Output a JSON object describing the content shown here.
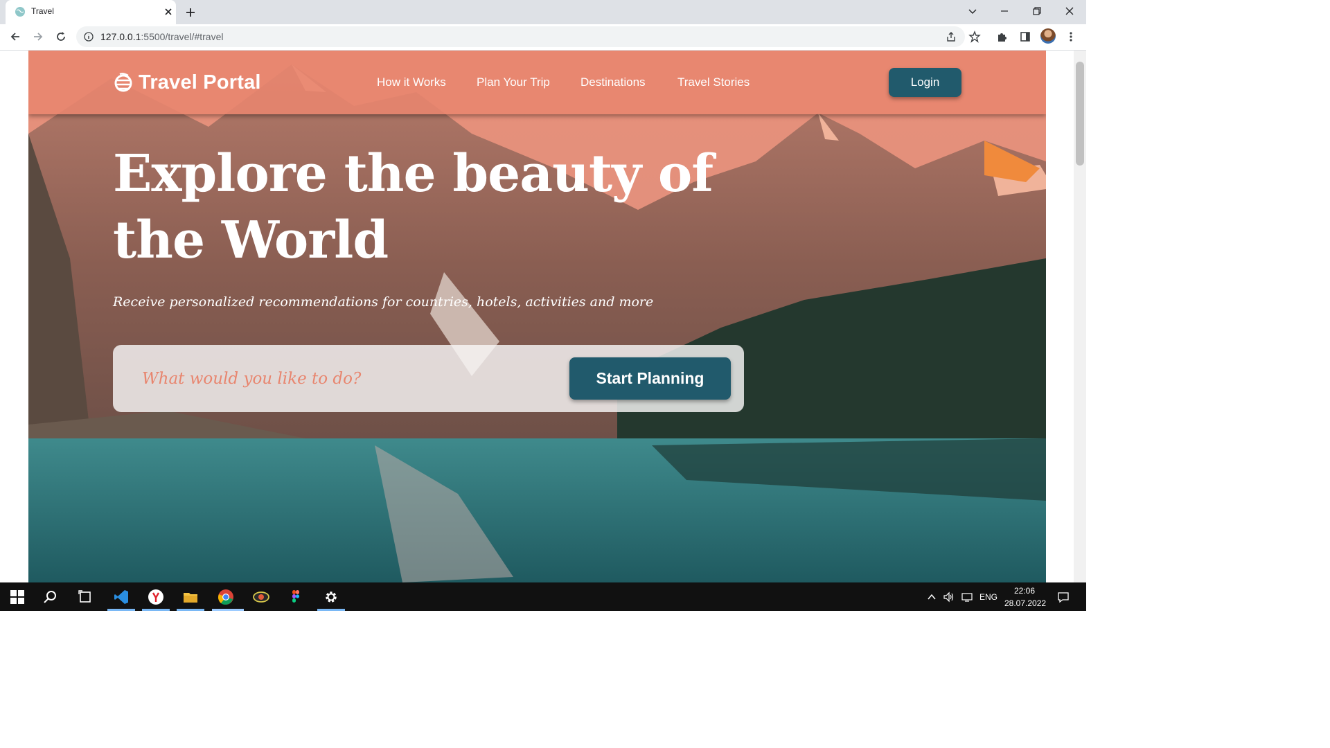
{
  "browser": {
    "tab_title": "Travel",
    "url_host": "127.0.0.1",
    "url_rest": ":5500/travel/#travel"
  },
  "nav": {
    "brand": "Travel Portal",
    "links": [
      "How it Works",
      "Plan Your Trip",
      "Destinations",
      "Travel Stories"
    ],
    "login_label": "Login"
  },
  "hero": {
    "headline_line1": "Explore the beauty of",
    "headline_line2": "the World",
    "subtitle": "Receive personalized recommendations for countries, hotels, activities and more",
    "search_placeholder": "What would you like to do?",
    "cta_label": "Start Planning"
  },
  "taskbar": {
    "lang": "ENG",
    "time": "22:06",
    "date": "28.07.2022"
  },
  "colors": {
    "navbar": "#e8856e",
    "accent": "#215a6c",
    "placeholder": "#e8856e"
  }
}
